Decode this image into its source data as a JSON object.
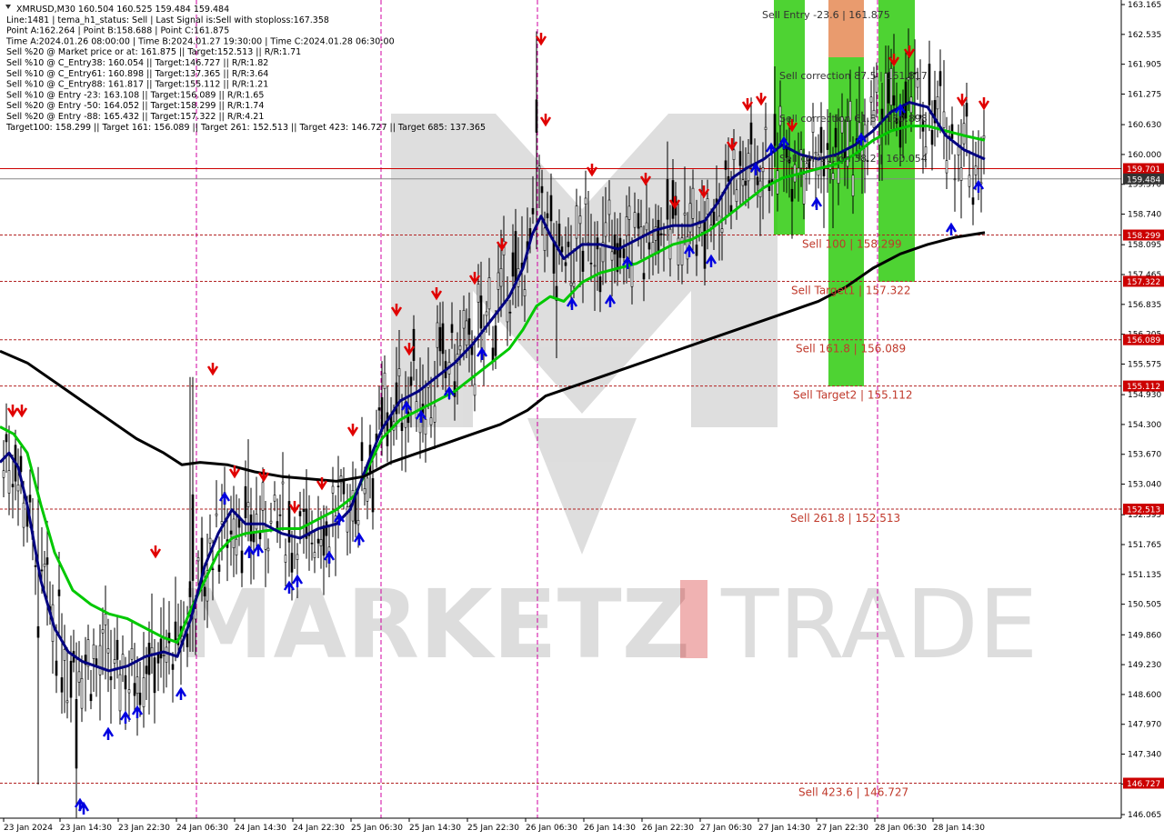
{
  "header": {
    "lines": [
      "XMRUSD,M30  160.504 160.525 159.484 159.484",
      "Line:1481 | tema_h1_status: Sell | Last Signal is:Sell with stoploss:167.358",
      "Point A:162.264 | Point B:158.688 | Point C:161.875",
      "Time A:2024.01.26 08:00:00 | Time B:2024.01.27 19:30:00 | Time C:2024.01.28 06:30:00",
      "Sell %20 @ Market price or at: 161.875 || Target:152.513 || R/R:1.71",
      "Sell %10 @ C_Entry38: 160.054 || Target:146.727 || R/R:1.82",
      "Sell %10 @ C_Entry61: 160.898 || Target:137.365 || R/R:3.64",
      "Sell %10 @ C_Entry88: 161.817 || Target:155.112 || R/R:1.21",
      "Sell %10 @ Entry -23: 163.108 || Target:156.089 || R/R:1.65",
      "Sell %20 @ Entry -50: 164.052 || Target:158.299 || R/R:1.74",
      "Sell %20 @ Entry -88: 165.432 || Target:157.322 || R/R:4.21",
      "Target100: 158.299 || Target 161: 156.089 || Target 261: 152.513 || Target 423: 146.727 || Target 685: 137.365"
    ]
  },
  "watermark": {
    "left": "MARKETZ",
    "mid": "I",
    "right": "TRADE"
  },
  "chart_data": {
    "type": "line",
    "symbol": "XMRUSD",
    "timeframe": "M30",
    "ylim": [
      146.0,
      163.2
    ],
    "y_ticks": [
      "163.165",
      "162.535",
      "161.905",
      "161.275",
      "160.630",
      "160.000",
      "159.370",
      "158.740",
      "158.095",
      "157.465",
      "156.835",
      "156.205",
      "155.575",
      "154.930",
      "154.300",
      "153.670",
      "153.040",
      "152.395",
      "151.765",
      "151.135",
      "150.505",
      "149.860",
      "149.230",
      "148.600",
      "147.970",
      "147.340",
      "146.710",
      "146.065"
    ],
    "x_ticks": [
      "23 Jan 2024",
      "23 Jan 14:30",
      "23 Jan 22:30",
      "24 Jan 06:30",
      "24 Jan 14:30",
      "24 Jan 22:30",
      "25 Jan 06:30",
      "25 Jan 14:30",
      "25 Jan 22:30",
      "26 Jan 06:30",
      "26 Jan 14:30",
      "26 Jan 22:30",
      "27 Jan 06:30",
      "27 Jan 14:30",
      "27 Jan 22:30",
      "28 Jan 06:30",
      "28 Jan 14:30"
    ],
    "levels": [
      {
        "price": 159.701,
        "label": "",
        "tag": "159.701",
        "color": "#cc0000",
        "style": "solid"
      },
      {
        "price": 159.484,
        "label": "",
        "tag": "159.484",
        "color": "#888888",
        "style": "solid"
      },
      {
        "price": 158.299,
        "label": "Sell 100 | 158.299",
        "tag": "158.299",
        "color": "#b22222",
        "style": "dashed"
      },
      {
        "price": 157.322,
        "label": "Sell Target1 | 157.322",
        "tag": "157.322",
        "color": "#b22222",
        "style": "dashed"
      },
      {
        "price": 156.089,
        "label": "Sell 161.8 | 156.089",
        "tag": "156.089",
        "color": "#b22222",
        "style": "dashed"
      },
      {
        "price": 155.112,
        "label": "Sell Target2 | 155.112",
        "tag": "155.112",
        "color": "#b22222",
        "style": "dashed"
      },
      {
        "price": 152.513,
        "label": "Sell 261.8 | 152.513",
        "tag": "152.513",
        "color": "#b22222",
        "style": "dashed"
      },
      {
        "price": 146.727,
        "label": "Sell 423.6 | 146.727",
        "tag": "146.727",
        "color": "#b22222",
        "style": "dashed"
      }
    ],
    "zone_labels": [
      "Sell Entry -23.6 | 161.875",
      "Sell correction 87.5 | 161.817",
      "Sell correction 61.8 | 160.898",
      "Sell correction 38.2 | 160.054"
    ],
    "series": [
      {
        "name": "",
        "color": "#00c800",
        "values": [
          [
            0,
            154.25
          ],
          [
            15,
            154.1
          ],
          [
            30,
            153.7
          ],
          [
            45,
            152.6
          ],
          [
            60,
            151.6
          ],
          [
            80,
            150.8
          ],
          [
            100,
            150.5
          ],
          [
            120,
            150.3
          ],
          [
            140,
            150.2
          ],
          [
            160,
            150.0
          ],
          [
            180,
            149.8
          ],
          [
            195,
            149.7
          ],
          [
            210,
            150.4
          ],
          [
            225,
            151.0
          ],
          [
            240,
            151.6
          ],
          [
            255,
            151.9
          ],
          [
            270,
            152.0
          ],
          [
            290,
            152.05
          ],
          [
            310,
            152.1
          ],
          [
            330,
            152.1
          ],
          [
            350,
            152.3
          ],
          [
            370,
            152.5
          ],
          [
            390,
            152.8
          ],
          [
            400,
            153.2
          ],
          [
            410,
            153.6
          ],
          [
            420,
            154.0
          ],
          [
            440,
            154.4
          ],
          [
            460,
            154.6
          ],
          [
            480,
            154.8
          ],
          [
            500,
            155.0
          ],
          [
            520,
            155.3
          ],
          [
            540,
            155.6
          ],
          [
            560,
            155.9
          ],
          [
            575,
            156.3
          ],
          [
            590,
            156.8
          ],
          [
            605,
            157.0
          ],
          [
            620,
            156.9
          ],
          [
            640,
            157.3
          ],
          [
            660,
            157.5
          ],
          [
            680,
            157.6
          ],
          [
            700,
            157.7
          ],
          [
            720,
            157.9
          ],
          [
            740,
            158.1
          ],
          [
            760,
            158.2
          ],
          [
            780,
            158.4
          ],
          [
            800,
            158.7
          ],
          [
            820,
            159.0
          ],
          [
            840,
            159.3
          ],
          [
            860,
            159.5
          ],
          [
            880,
            159.6
          ],
          [
            900,
            159.7
          ],
          [
            920,
            159.8
          ],
          [
            940,
            160.0
          ],
          [
            960,
            160.3
          ],
          [
            980,
            160.5
          ],
          [
            1000,
            160.6
          ],
          [
            1020,
            160.6
          ],
          [
            1040,
            160.5
          ],
          [
            1060,
            160.4
          ],
          [
            1083,
            160.3
          ]
        ]
      },
      {
        "name": "",
        "color": "#000080",
        "values": [
          [
            0,
            153.5
          ],
          [
            10,
            153.7
          ],
          [
            20,
            153.4
          ],
          [
            30,
            152.6
          ],
          [
            45,
            151.0
          ],
          [
            60,
            150.0
          ],
          [
            75,
            149.5
          ],
          [
            90,
            149.3
          ],
          [
            105,
            149.2
          ],
          [
            120,
            149.1
          ],
          [
            140,
            149.2
          ],
          [
            160,
            149.4
          ],
          [
            180,
            149.5
          ],
          [
            195,
            149.4
          ],
          [
            210,
            150.2
          ],
          [
            225,
            151.3
          ],
          [
            240,
            152.0
          ],
          [
            255,
            152.5
          ],
          [
            270,
            152.2
          ],
          [
            290,
            152.2
          ],
          [
            310,
            152.0
          ],
          [
            330,
            151.9
          ],
          [
            350,
            152.1
          ],
          [
            370,
            152.2
          ],
          [
            385,
            152.5
          ],
          [
            395,
            153.0
          ],
          [
            405,
            153.5
          ],
          [
            420,
            154.2
          ],
          [
            440,
            154.8
          ],
          [
            460,
            155.0
          ],
          [
            480,
            155.3
          ],
          [
            500,
            155.6
          ],
          [
            520,
            156.0
          ],
          [
            540,
            156.5
          ],
          [
            560,
            157.0
          ],
          [
            575,
            157.6
          ],
          [
            585,
            158.3
          ],
          [
            595,
            158.7
          ],
          [
            605,
            158.3
          ],
          [
            620,
            157.8
          ],
          [
            640,
            158.1
          ],
          [
            660,
            158.1
          ],
          [
            680,
            158.0
          ],
          [
            700,
            158.2
          ],
          [
            720,
            158.4
          ],
          [
            740,
            158.5
          ],
          [
            760,
            158.5
          ],
          [
            775,
            158.6
          ],
          [
            790,
            159.0
          ],
          [
            805,
            159.5
          ],
          [
            820,
            159.7
          ],
          [
            840,
            159.9
          ],
          [
            860,
            160.2
          ],
          [
            880,
            160.0
          ],
          [
            900,
            159.9
          ],
          [
            920,
            160.0
          ],
          [
            940,
            160.2
          ],
          [
            960,
            160.5
          ],
          [
            980,
            160.9
          ],
          [
            1000,
            161.1
          ],
          [
            1020,
            161.0
          ],
          [
            1040,
            160.4
          ],
          [
            1060,
            160.1
          ],
          [
            1083,
            159.9
          ]
        ]
      },
      {
        "name": "",
        "color": "#000000",
        "values": [
          [
            0,
            155.85
          ],
          [
            30,
            155.6
          ],
          [
            60,
            155.2
          ],
          [
            90,
            154.8
          ],
          [
            120,
            154.4
          ],
          [
            150,
            154.0
          ],
          [
            180,
            153.7
          ],
          [
            200,
            153.45
          ],
          [
            220,
            153.5
          ],
          [
            250,
            153.45
          ],
          [
            280,
            153.3
          ],
          [
            310,
            153.2
          ],
          [
            340,
            153.15
          ],
          [
            370,
            153.1
          ],
          [
            400,
            153.2
          ],
          [
            430,
            153.5
          ],
          [
            460,
            153.7
          ],
          [
            490,
            153.9
          ],
          [
            520,
            154.1
          ],
          [
            550,
            154.3
          ],
          [
            580,
            154.6
          ],
          [
            600,
            154.9
          ],
          [
            630,
            155.1
          ],
          [
            660,
            155.3
          ],
          [
            690,
            155.5
          ],
          [
            720,
            155.7
          ],
          [
            750,
            155.9
          ],
          [
            780,
            156.1
          ],
          [
            810,
            156.3
          ],
          [
            840,
            156.5
          ],
          [
            870,
            156.7
          ],
          [
            900,
            156.9
          ],
          [
            930,
            157.2
          ],
          [
            960,
            157.6
          ],
          [
            990,
            157.9
          ],
          [
            1020,
            158.1
          ],
          [
            1050,
            158.25
          ],
          [
            1083,
            158.35
          ]
        ]
      }
    ]
  }
}
